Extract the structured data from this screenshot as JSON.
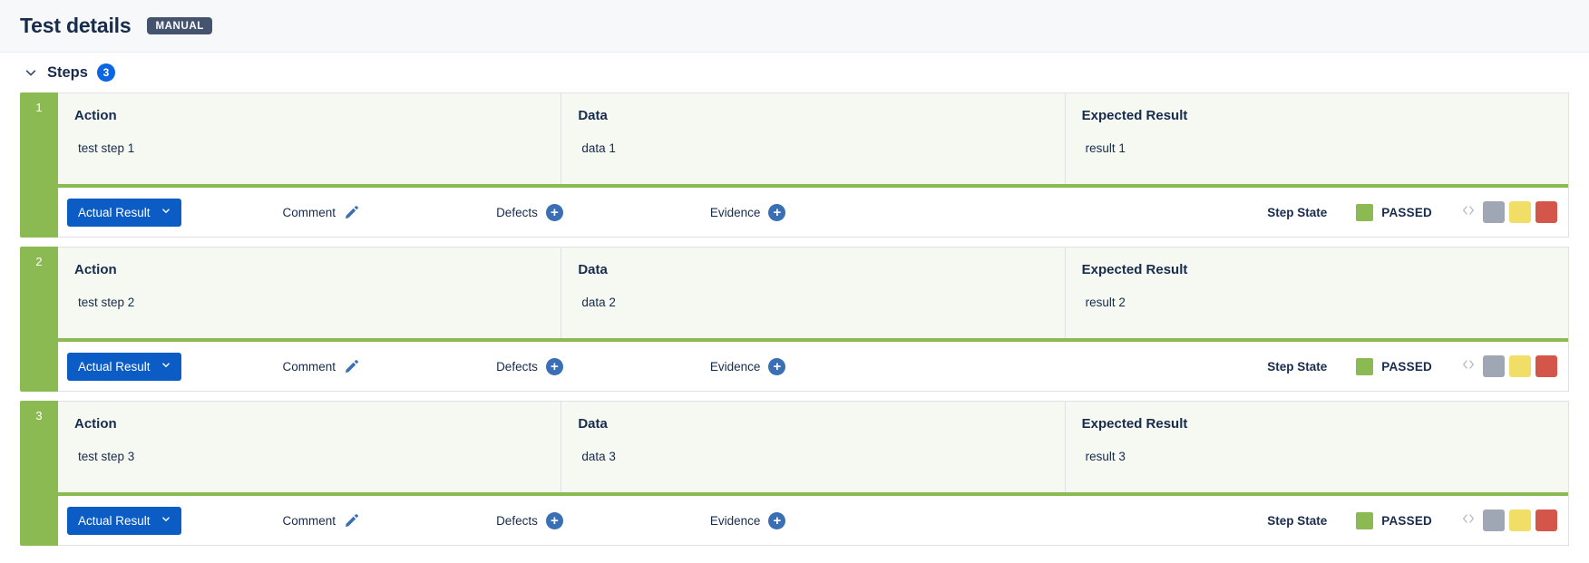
{
  "header": {
    "title": "Test details",
    "badge": "MANUAL"
  },
  "steps_section": {
    "label": "Steps",
    "count": "3",
    "chevron_icon": "chevron-down-icon"
  },
  "columns": {
    "action": "Action",
    "data": "Data",
    "expected_result": "Expected Result"
  },
  "action_bar": {
    "actual_result_label": "Actual Result",
    "actual_result_caret": "⌄",
    "comment_label": "Comment",
    "comment_icon": "pencil-icon",
    "defects_label": "Defects",
    "defects_icon": "plus-circle-icon",
    "evidence_label": "Evidence",
    "evidence_icon": "plus-circle-icon",
    "step_state_label": "Step State",
    "code_icon": "code-icon"
  },
  "status_colors": {
    "passed": "#8cba52",
    "todo": "#9ea7b3",
    "executing": "#f0de67",
    "failed": "#d4564b"
  },
  "status_buttons": [
    {
      "name": "todo-status-button",
      "color": "#9ea7b3"
    },
    {
      "name": "executing-status-button",
      "color": "#f0de67"
    },
    {
      "name": "failed-status-button",
      "color": "#d4564b"
    }
  ],
  "steps": [
    {
      "number": "1",
      "action": "test step 1",
      "data": "data 1",
      "expected_result": "result 1",
      "status": "PASSED"
    },
    {
      "number": "2",
      "action": "test step 2",
      "data": "data 2",
      "expected_result": "result 2",
      "status": "PASSED"
    },
    {
      "number": "3",
      "action": "test step 3",
      "data": "data 3",
      "expected_result": "result 3",
      "status": "PASSED"
    }
  ]
}
